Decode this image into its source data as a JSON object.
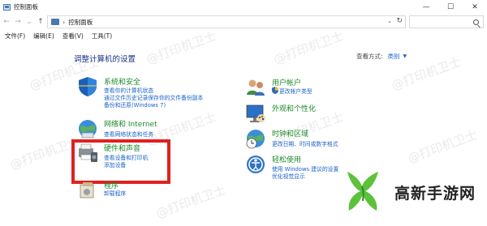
{
  "window": {
    "title": "控制面板",
    "minimize": "—",
    "maximize": "☐",
    "close": "✕"
  },
  "address": {
    "back": "←",
    "forward": "→",
    "history": "⌄",
    "up": "↑",
    "separator": "›",
    "breadcrumb": "控制面板",
    "dropdown": "⌄",
    "refresh": "↻"
  },
  "menu": [
    "文件(F)",
    "编辑(E)",
    "查看(V)",
    "工具(T)"
  ],
  "content": {
    "heading": "调整计算机的设置",
    "view_by_label": "查看方式:",
    "view_by_value": "类别",
    "view_by_caret": "▼"
  },
  "categories_left": [
    {
      "title": "系统和安全",
      "links": [
        "查看你的计算机状态",
        "通过文件历史记录保存你的文件备份副本",
        "备份和还原(Windows 7)"
      ]
    },
    {
      "title": "网络和 Internet",
      "links": [
        "查看网络状态和任务"
      ]
    },
    {
      "title": "硬件和声音",
      "links": [
        "查看设备和打印机",
        "添加设备"
      ]
    },
    {
      "title": "程序",
      "links": [
        "卸载程序"
      ]
    }
  ],
  "categories_right": [
    {
      "title": "用户帐户",
      "links": [
        "更改帐户类型"
      ]
    },
    {
      "title": "外观和个性化",
      "links": []
    },
    {
      "title": "时钟和区域",
      "links": [
        "更改日期、时间或数字格式"
      ]
    },
    {
      "title": "轻松使用",
      "links": [
        "使用 Windows 建议的设置",
        "优化视觉显示"
      ]
    }
  ],
  "watermark": "@打印机卫士",
  "brand": {
    "text": "高新手游网",
    "green": "#5cc23a",
    "dark_green": "#2f8a25"
  },
  "colors": {
    "highlight": "#e02020",
    "link": "#1a63c6",
    "category_title": "#1e8a2a",
    "heading": "#1e3287"
  }
}
